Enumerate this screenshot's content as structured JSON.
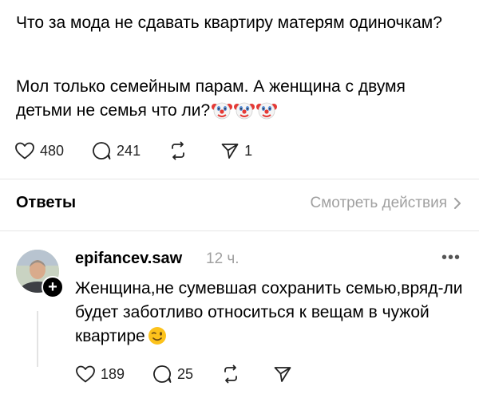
{
  "post": {
    "paragraph1": "Что за мода не сдавать квартиру матерям одиночкам?",
    "paragraph2": "Мол только семейным парам. А женщина с двумя детьми не семья что ли?",
    "emoji": [
      "clown-face",
      "clown-face",
      "clown-face"
    ],
    "likes": "480",
    "comments": "241",
    "shares": "1"
  },
  "replies_header": {
    "title": "Ответы",
    "view_activity": "Смотреть действия"
  },
  "reply": {
    "username": "epifancev.saw",
    "time": "12 ч.",
    "text": "Женщина,не сумевшая сохранить семью,вряд-ли будет заботливо относиться к вещам в чужой квартире",
    "emoji": "winking-face",
    "likes": "189",
    "comments": "25"
  }
}
